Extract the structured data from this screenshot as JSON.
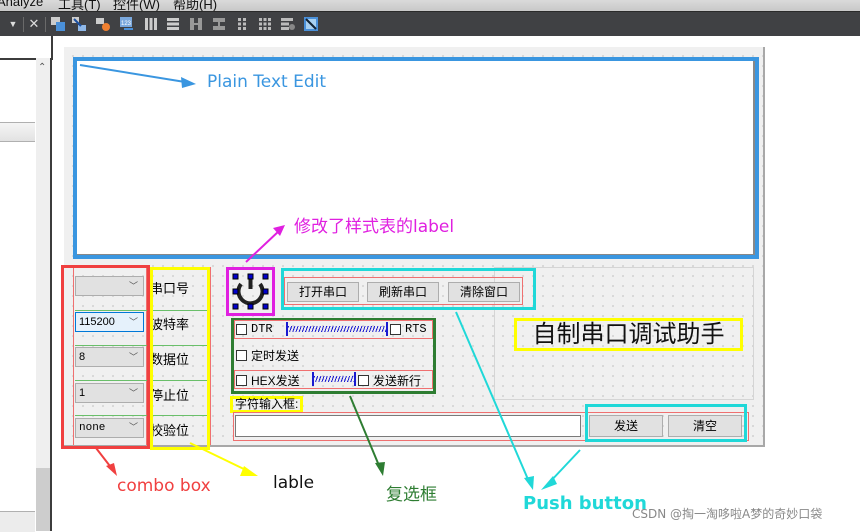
{
  "menubar": {
    "items": [
      "Analyze",
      "工具(T)",
      "控件(W)",
      "帮助(H)"
    ]
  },
  "toolbar": {
    "icons": [
      "dropdown-arrow-icon",
      "close-icon",
      "edit-widgets-icon",
      "edit-signals-slots-icon",
      "edit-buddies-icon",
      "edit-tab-order-icon",
      "layout-horizontal-icon",
      "layout-vertical-icon",
      "layout-horizontal-splitter-icon",
      "layout-vertical-splitter-icon",
      "layout-form-icon",
      "layout-grid-icon",
      "break-layout-icon",
      "adjust-size-icon"
    ]
  },
  "form": {
    "combos": [
      {
        "value": "",
        "active": false
      },
      {
        "value": "115200",
        "active": true
      },
      {
        "value": "8",
        "active": false
      },
      {
        "value": "1",
        "active": false
      },
      {
        "value": "none",
        "active": false
      }
    ],
    "labels": [
      "串口号",
      "波特率",
      "数据位",
      "停止位",
      "校验位"
    ],
    "top_buttons": [
      "打开串口",
      "刷新串口",
      "清除窗口"
    ],
    "checkboxes": {
      "dtr": "DTR",
      "rts": "RTS",
      "timed_send": "定时发送",
      "hex_send": "HEX发送",
      "send_newline": "发送新行"
    },
    "input_label": "字符输入框:",
    "input_value": "",
    "send_button": "发送",
    "clear_button": "清空",
    "title_label": "自制串口调试助手"
  },
  "annotations": {
    "plain_text_edit": "Plain Text Edit",
    "styled_label": "修改了样式表的label",
    "combo_box": "combo box",
    "label": "lable",
    "checkbox": "复选框",
    "push_button": "Push button",
    "colors": {
      "plain_text_edit": "#3a96e0",
      "styled_label": "#e020e0",
      "combo_box": "#f04040",
      "label": "#ffff00",
      "checkbox": "#2e7d32",
      "push_button": "#20d8d8"
    }
  },
  "watermark": "CSDN @掏一淘哆啦A梦的奇妙口袋"
}
